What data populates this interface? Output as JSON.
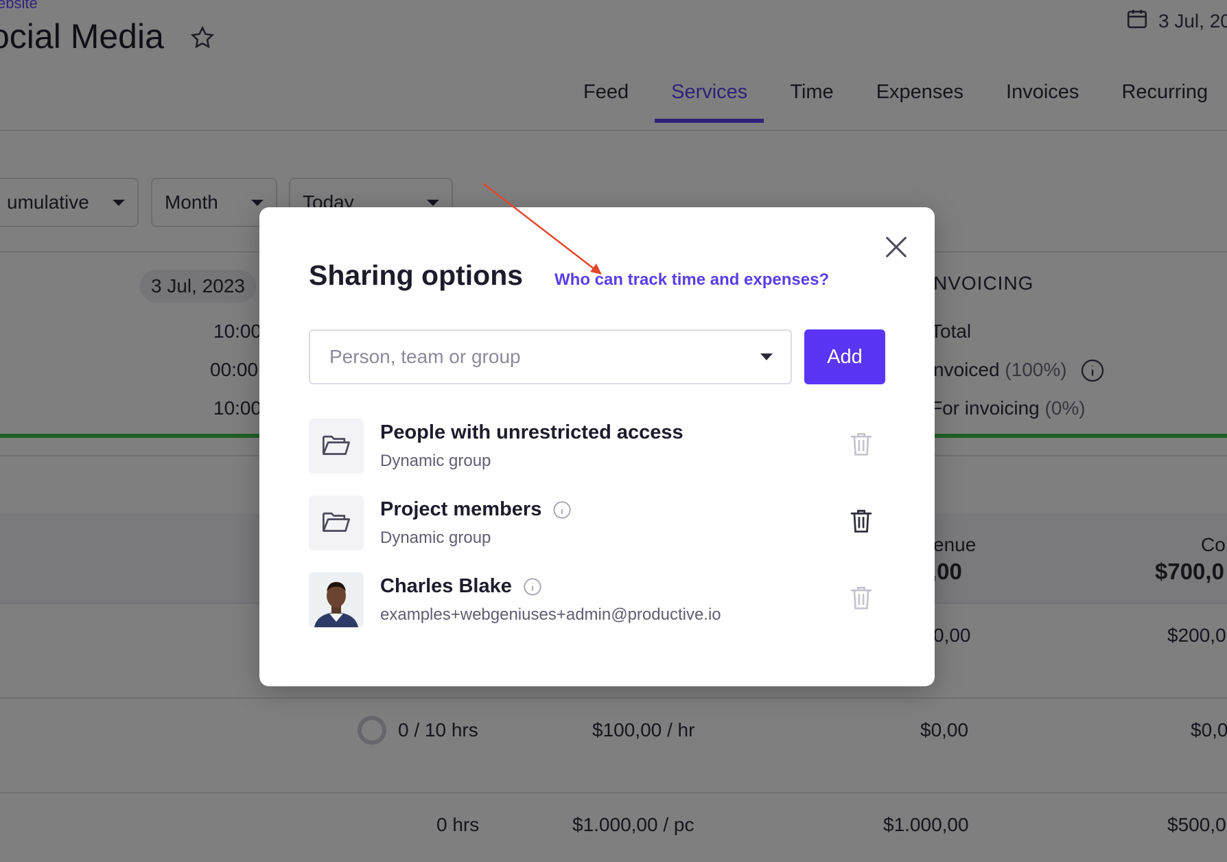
{
  "background": {
    "breadcrumb": "ebsite",
    "title": "ocial Media",
    "date_top": "3 Jul, 20",
    "tabs": [
      {
        "label": "Feed",
        "active": false
      },
      {
        "label": "Services",
        "active": true
      },
      {
        "label": "Time",
        "active": false
      },
      {
        "label": "Expenses",
        "active": false
      },
      {
        "label": "Invoices",
        "active": false
      },
      {
        "label": "Recurring",
        "active": false
      }
    ],
    "filters": [
      "umulative",
      "Month",
      "Today"
    ],
    "date_pill": "3 Jul, 2023",
    "times": [
      "10:00",
      "00:00",
      "10:00"
    ],
    "invoicing": {
      "heading": "NVOICING",
      "total_label": "Total",
      "invoiced_label": "nvoiced",
      "invoiced_pct": "(100%)",
      "for_invoicing_label": "For invoicing",
      "for_invoicing_pct": "(0%)"
    },
    "table": {
      "col_revenue_label": "enue",
      "col_revenue_value": ",00",
      "col_cost_label": "Co",
      "col_cost_value": "$700,0",
      "rows": [
        {
          "hrs": "",
          "rate": "",
          "revenue": "0,00",
          "cost": "$200,0"
        },
        {
          "hrs": "0 / 10 hrs",
          "rate": "$100,00 / hr",
          "revenue": "$0,00",
          "cost": "$0,0"
        },
        {
          "hrs": "0 hrs",
          "rate": "$1.000,00 / pc",
          "revenue": "$1.000,00",
          "cost": "$500,0"
        }
      ]
    }
  },
  "modal": {
    "title": "Sharing options",
    "help_link": "Who can track time and expenses?",
    "input_placeholder": "Person, team or group",
    "add_label": "Add",
    "items": [
      {
        "title": "People with unrestricted access",
        "subtitle": "Dynamic group",
        "type": "group",
        "info": false,
        "deletable": false
      },
      {
        "title": "Project members",
        "subtitle": "Dynamic group",
        "type": "group",
        "info": true,
        "deletable": true
      },
      {
        "title": "Charles Blake",
        "subtitle": "examples+webgeniuses+admin@productive.io",
        "type": "person",
        "info": true,
        "deletable": false
      }
    ]
  },
  "colors": {
    "accent": "#5b35f5",
    "link": "#5c3ee8",
    "progress_green": "#3ec34a",
    "annotation_arrow": "#e2472c"
  }
}
